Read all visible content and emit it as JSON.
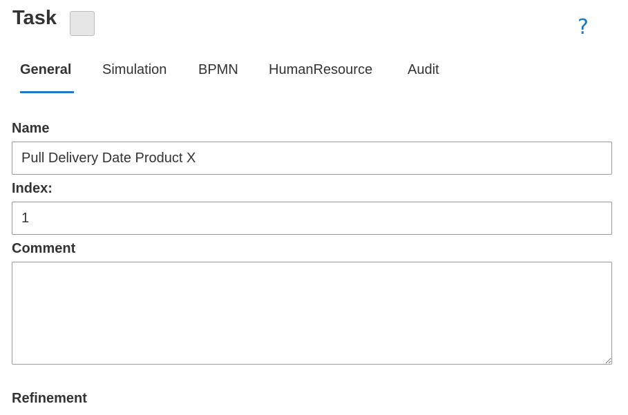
{
  "header": {
    "title": "Task",
    "help_icon": "?"
  },
  "tabs": [
    {
      "label": "General",
      "active": true
    },
    {
      "label": "Simulation",
      "active": false
    },
    {
      "label": "BPMN",
      "active": false
    },
    {
      "label": "HumanResource",
      "active": false
    },
    {
      "label": "Audit",
      "active": false
    }
  ],
  "form": {
    "name_label": "Name",
    "name_value": "Pull Delivery Date Product X",
    "index_label": "Index:",
    "index_value": "1",
    "comment_label": "Comment",
    "comment_value": "",
    "refinement_label": "Refinement"
  },
  "colors": {
    "accent": "#1a7ac8",
    "text": "#333333",
    "color_swatch": "#e6e6e6"
  },
  "icons": {
    "help": "help-icon",
    "resize_handle": "resize-grip-icon"
  }
}
